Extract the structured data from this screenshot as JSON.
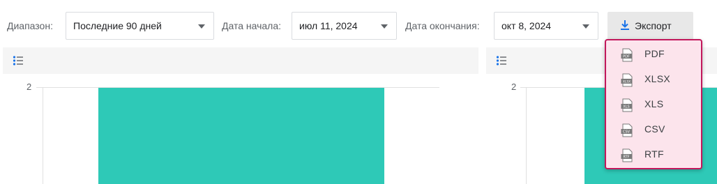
{
  "filters": {
    "range_label": "Диапазон:",
    "range_value": "Последние 90 дней",
    "start_label": "Дата начала:",
    "start_value": "июл 11, 2024",
    "end_label": "Дата окончания:",
    "end_value": "окт 8, 2024"
  },
  "export": {
    "label": "Экспорт",
    "options": [
      {
        "label": "PDF",
        "icon": "pdf-file-icon",
        "tag": "PDF"
      },
      {
        "label": "XLSX",
        "icon": "xlsx-file-icon",
        "tag": "XLSX"
      },
      {
        "label": "XLS",
        "icon": "xls-file-icon",
        "tag": "XLS"
      },
      {
        "label": "CSV",
        "icon": "csv-file-icon",
        "tag": "CSV"
      },
      {
        "label": "RTF",
        "icon": "rtf-file-icon",
        "tag": "RTF"
      }
    ]
  },
  "colors": {
    "bar": "#2ec9b7",
    "menu_border": "#c2185b",
    "menu_bg": "#fce4ec"
  },
  "charts": {
    "left_tick": "2",
    "right_tick": "2"
  },
  "chart_data": [
    {
      "type": "bar",
      "ytick_labels": [
        "2"
      ],
      "values": [
        2
      ]
    },
    {
      "type": "bar",
      "ytick_labels": [
        "2"
      ],
      "values": [
        2
      ]
    }
  ]
}
